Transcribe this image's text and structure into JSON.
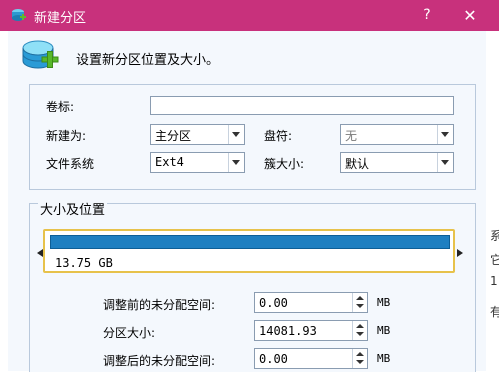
{
  "window": {
    "title": "新建分区",
    "help": "?",
    "close": "✕"
  },
  "header": {
    "text": "设置新分区位置及大小。"
  },
  "form": {
    "volume_label": "卷标:",
    "volume_value": "",
    "create_as_label": "新建为:",
    "create_as_value": "主分区",
    "drive_letter_label": "盘符:",
    "drive_letter_value": "无",
    "filesystem_label": "文件系统",
    "filesystem_value": "Ext4",
    "cluster_size_label": "簇大小:",
    "cluster_size_value": "默认"
  },
  "size_position": {
    "title": "大小及位置",
    "partition_size": "13.75 GB",
    "partition_fill": 1.0,
    "before_label": "调整前的未分配空间:",
    "before_value": "0.00",
    "size_label": "分区大小:",
    "size_value": "14081.93",
    "after_label": "调整后的未分配空间:",
    "after_value": "0.00",
    "unit": "MB"
  },
  "background_edge": [
    "系",
    "它",
    "1",
    "有"
  ],
  "colors": {
    "titlebar": "#c8317c",
    "partition_bar": "#1e7fc1",
    "selection_border": "#e7c24b"
  }
}
